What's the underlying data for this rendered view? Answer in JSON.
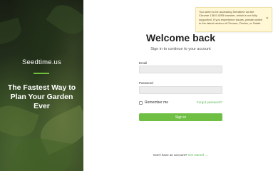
{
  "brand": {
    "name": "Seedtime.us",
    "tagline": "The Fastest Way to Plan Your Garden Ever",
    "accent_color": "#6fbf44"
  },
  "login": {
    "title": "Welcome back",
    "subtitle": "Sign in to continue to your account",
    "email_label": "Email",
    "email_value": "",
    "password_label": "Password",
    "password_value": "",
    "remember_label": "Remember me",
    "forgot_link": "Forgot password?",
    "submit_label": "Sign in",
    "signup_prompt": "Don't have an account?",
    "signup_link": "Get started →"
  },
  "browser_warning": {
    "message": "You seem to be accessing Seedtime via the Chrome 138.0.4295 browser, which is not fully supported. If you experience issues, please switch to the latest version of Chrome, Firefox, or Safari.",
    "close_icon": "close-icon"
  }
}
